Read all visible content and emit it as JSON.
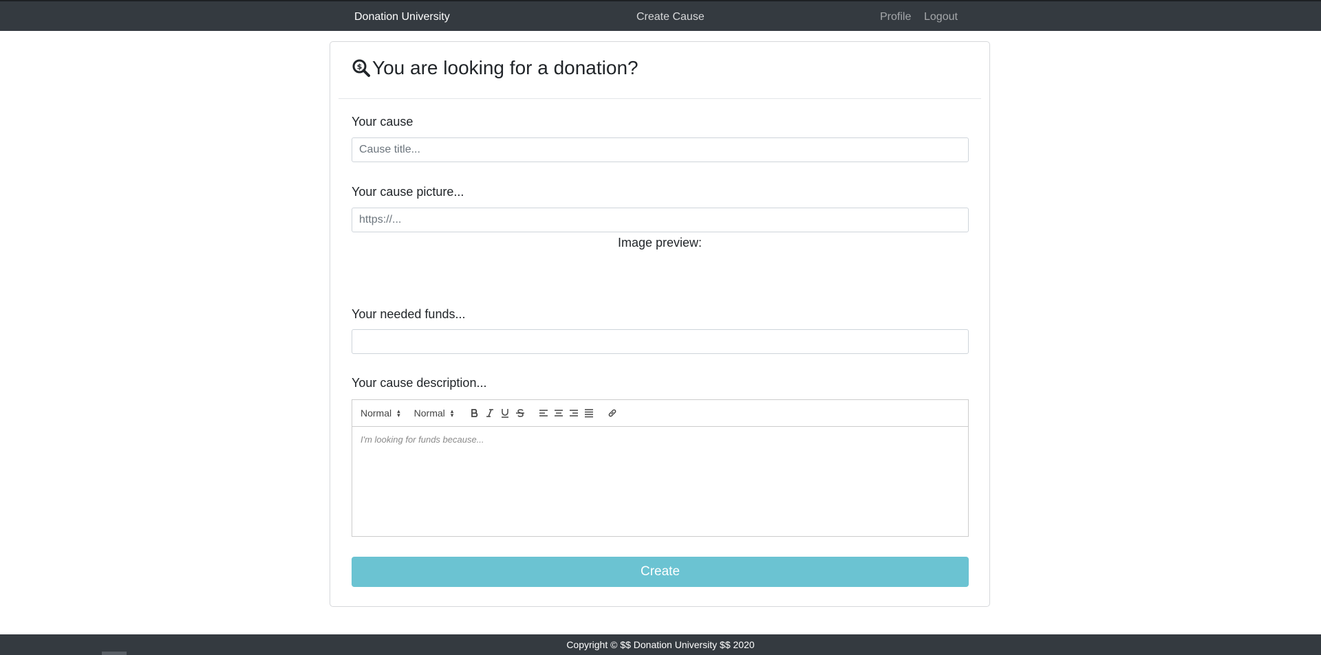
{
  "navbar": {
    "brand": "Donation University",
    "create_cause": "Create Cause",
    "profile": "Profile",
    "logout": "Logout"
  },
  "card": {
    "title": "You are looking for a donation?",
    "title_icon": "search-dollar-icon",
    "cause_label": "Your cause",
    "cause_placeholder": "Cause title...",
    "cause_value": "",
    "picture_label": "Your cause picture...",
    "picture_placeholder": "https://...",
    "picture_value": "",
    "preview_label": "Image preview:",
    "funds_label": "Your needed funds...",
    "funds_value": "",
    "description_label": "Your cause description...",
    "editor": {
      "font_size_picker": "Normal",
      "header_picker": "Normal",
      "buttons": [
        "bold-icon",
        "italic-icon",
        "underline-icon",
        "strike-icon",
        "align-left-icon",
        "align-center-icon",
        "align-right-icon",
        "align-justify-icon",
        "link-icon"
      ],
      "placeholder": "I'm looking for funds because..."
    },
    "create_button": "Create"
  },
  "footer": {
    "text": "Copyright © $$ Donation University $$ 2020"
  }
}
